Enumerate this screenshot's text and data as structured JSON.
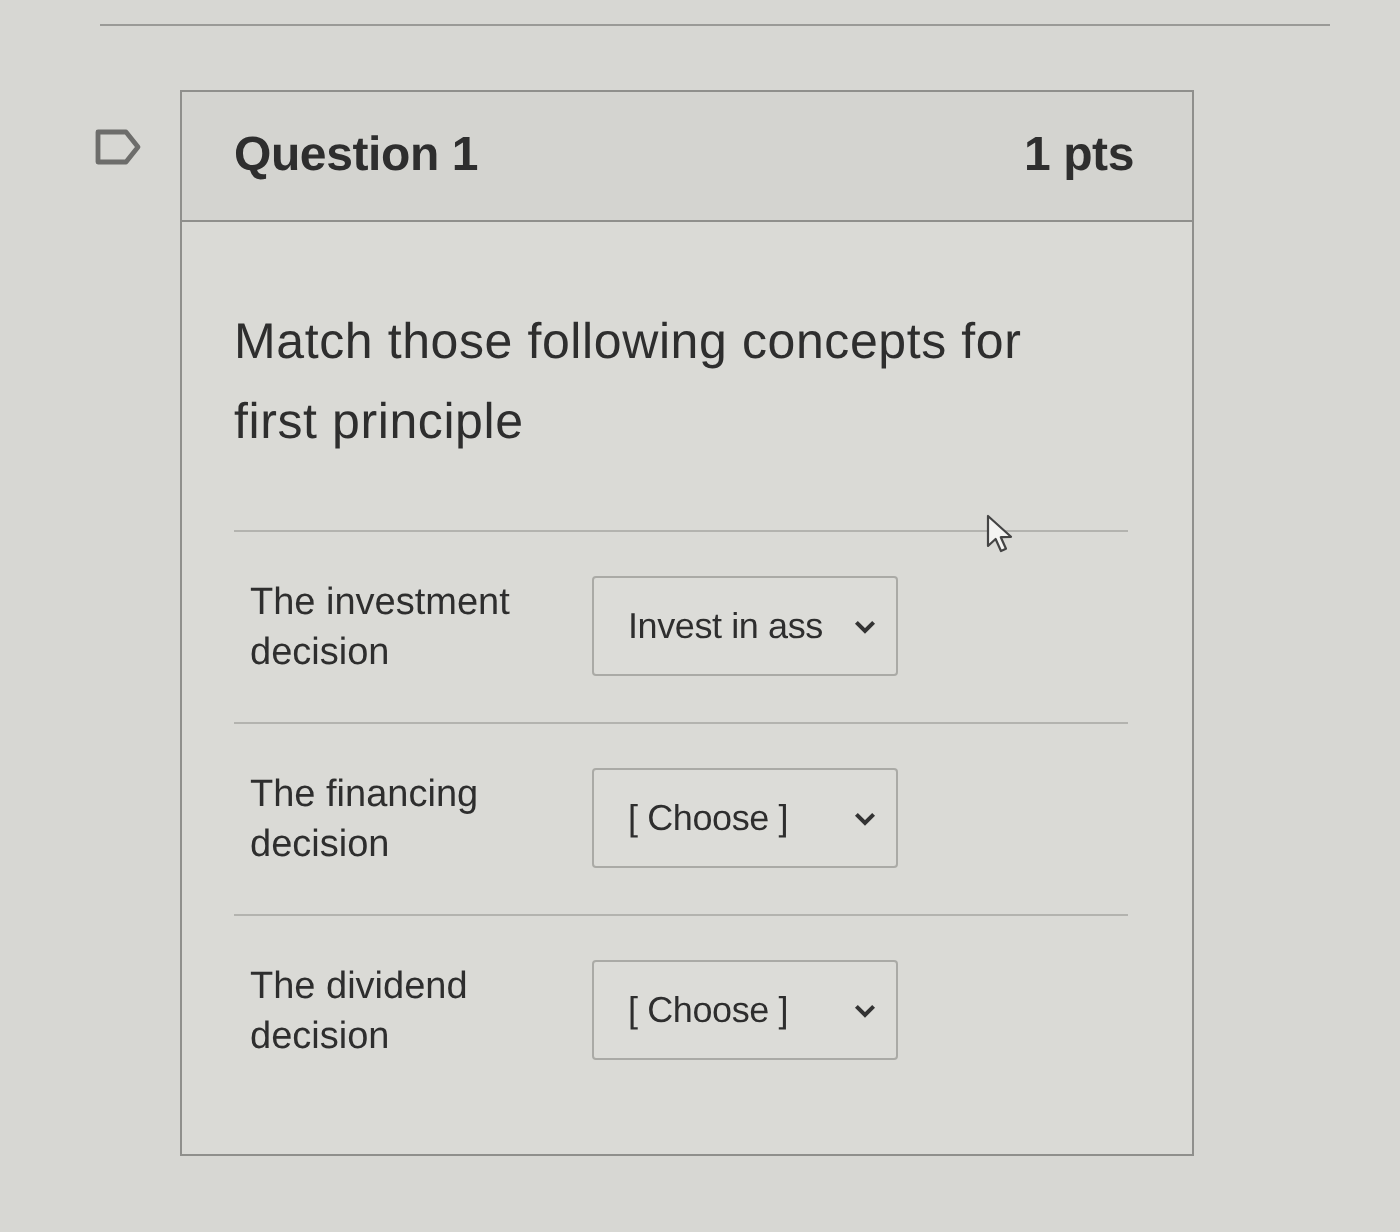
{
  "question": {
    "title": "Question 1",
    "points": "1 pts",
    "text": "Match those following concepts for first principle",
    "matches": [
      {
        "prompt": "The investment decision",
        "value": "Invest in ass"
      },
      {
        "prompt": "The financing decision",
        "value": "[ Choose ]"
      },
      {
        "prompt": "The dividend decision",
        "value": "[ Choose ]"
      }
    ]
  }
}
